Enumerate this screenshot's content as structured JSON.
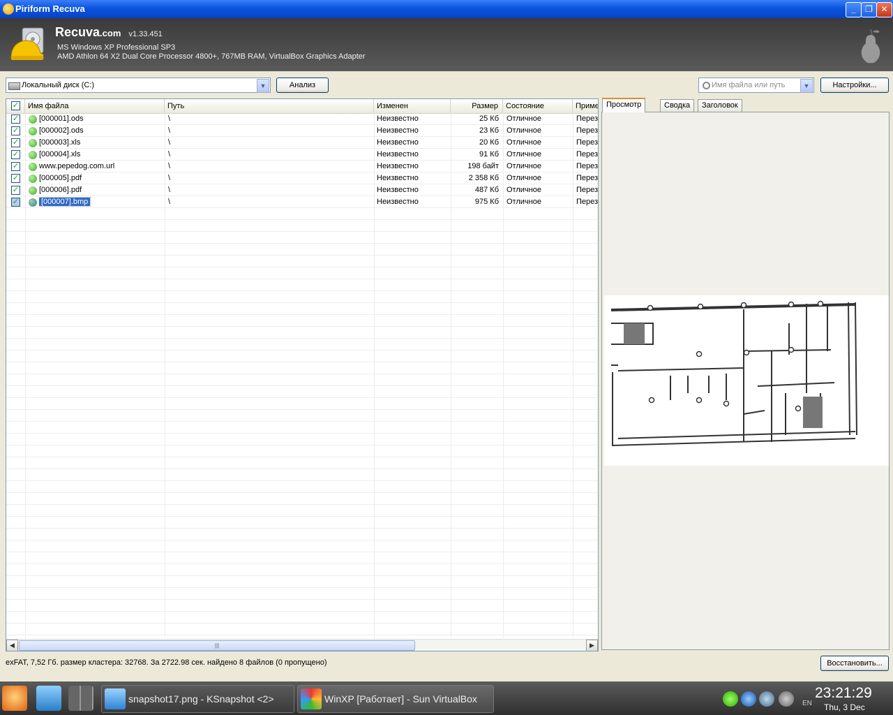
{
  "window": {
    "title": "Piriform Recuva",
    "min": "_",
    "max": "❐",
    "close": "✕"
  },
  "header": {
    "brand": "Recuva",
    "brand_suffix": ".com",
    "version": "v1.33.451",
    "os": "MS Windows XP Professional SP3",
    "hw": "AMD Athlon 64 X2 Dual Core Processor 4800+, 767MB RAM, VirtualBox Graphics Adapter"
  },
  "toolbar": {
    "drive": "Локальный диск (C:)",
    "analyze": "Анализ",
    "search_placeholder": "Имя файла или путь",
    "settings": "Настройки..."
  },
  "columns": [
    "Имя файла",
    "Путь",
    "Изменен",
    "Размер",
    "Состояние",
    "Приме"
  ],
  "files": [
    {
      "name": "[000001].ods",
      "path": "\\",
      "modified": "Неизвестно",
      "size": "25 Кб",
      "state": "Отличное",
      "note": "Перез"
    },
    {
      "name": "[000002].ods",
      "path": "\\",
      "modified": "Неизвестно",
      "size": "23 Кб",
      "state": "Отличное",
      "note": "Перез"
    },
    {
      "name": "[000003].xls",
      "path": "\\",
      "modified": "Неизвестно",
      "size": "20 Кб",
      "state": "Отличное",
      "note": "Перез"
    },
    {
      "name": "[000004].xls",
      "path": "\\",
      "modified": "Неизвестно",
      "size": "91 Кб",
      "state": "Отличное",
      "note": "Перез"
    },
    {
      "name": "www.pepedog.com.url",
      "path": "\\",
      "modified": "Неизвестно",
      "size": "198 байт",
      "state": "Отличное",
      "note": "Перез"
    },
    {
      "name": "[000005].pdf",
      "path": "\\",
      "modified": "Неизвестно",
      "size": "2 358 Кб",
      "state": "Отличное",
      "note": "Перез"
    },
    {
      "name": "[000006].pdf",
      "path": "\\",
      "modified": "Неизвестно",
      "size": "487 Кб",
      "state": "Отличное",
      "note": "Перез"
    },
    {
      "name": "[000007].bmp",
      "path": "\\",
      "modified": "Неизвестно",
      "size": "975 Кб",
      "state": "Отличное",
      "note": "Перез"
    }
  ],
  "selected_index": 7,
  "preview_tabs": [
    "Просмотр",
    "Сводка",
    "Заголовок"
  ],
  "status": "exFAT, 7,52 Гб. размер кластера: 32768. За 2722.98 сек. найдено 8 файлов (0 пропущено)",
  "restore": "Восстановить...",
  "taskbar": {
    "tasks": [
      "snapshot17.png - KSnapshot <2>",
      "WinXP [Работает] - Sun VirtualBox"
    ],
    "lang": "EN",
    "clock": "23:21:29",
    "date": "Thu, 3 Dec"
  },
  "colors": {
    "title_blue": "#0a55e0",
    "selection": "#316ac5",
    "ok_green": "#3fa82a"
  }
}
